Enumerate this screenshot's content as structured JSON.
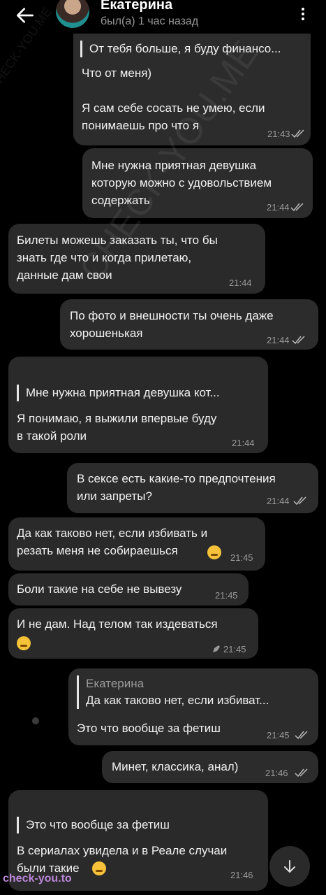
{
  "header": {
    "contact_name": "Екатерина",
    "status": "был(а) 1 час назад",
    "back_icon": "arrow-left-icon",
    "menu_icon": "more-vertical-icon"
  },
  "messages": [
    {
      "direction": "out",
      "reply_text": "От тебя больше, я буду финансо...",
      "text": "Что от меня)\n\nЯ сам себе сосать не умею, если\nпонимаешь про что я",
      "time": "21:43"
    },
    {
      "direction": "out",
      "text": "Мне нужна приятная девушка\nкоторую можно с удовольствием\nсодержать",
      "time": "21:44"
    },
    {
      "direction": "in",
      "text": "Билеты можешь заказать ты, что бы\nзнать где что и когда прилетаю,\nданные дам свои",
      "time": "21:44"
    },
    {
      "direction": "out",
      "text": "По фото и внешности ты очень даже\nхорошенькая",
      "time": "21:44"
    },
    {
      "direction": "in",
      "reply_text": "Мне нужна приятная девушка кот...",
      "text": "Я понимаю, я выжили впервые буду\nв такой роли",
      "time": "21:44"
    },
    {
      "direction": "out",
      "text": "В сексе есть какие-то предпочтения\nили запреты?",
      "time": "21:44"
    },
    {
      "direction": "in",
      "text": "Да как таково нет, если избивать и\nрезать меня не собираешься",
      "emoji": "sweat-smile-emoji",
      "time": "21:45"
    },
    {
      "direction": "in",
      "text": "Боли такие на себе не вывезу",
      "time": "21:45"
    },
    {
      "direction": "in",
      "text": "И не дам. Над телом так издеваться",
      "emoji": "crying-laughing-emoji",
      "edit_icon": "pencil-icon",
      "time": "21:45"
    },
    {
      "direction": "out",
      "reply_name": "Екатерина",
      "reply_text": "Да как таково нет, если избиват...",
      "text": "Это что вообще за фетиш",
      "time": "21:45"
    },
    {
      "direction": "out",
      "text": "Минет, классика, анал)",
      "time": "21:46"
    },
    {
      "direction": "in",
      "reply_text": "Это что вообще за фетиш",
      "text": "В сериалах увидела и в Реале случаи\nбыли такие",
      "emoji": "neutral-face-emoji",
      "time": "21:46"
    }
  ],
  "watermarks": {
    "big": "CHECK-YOU.ME",
    "small": "CHECK-YOU.ME",
    "site": "check-you.to"
  },
  "scroll_button_icon": "chevron-down-icon"
}
